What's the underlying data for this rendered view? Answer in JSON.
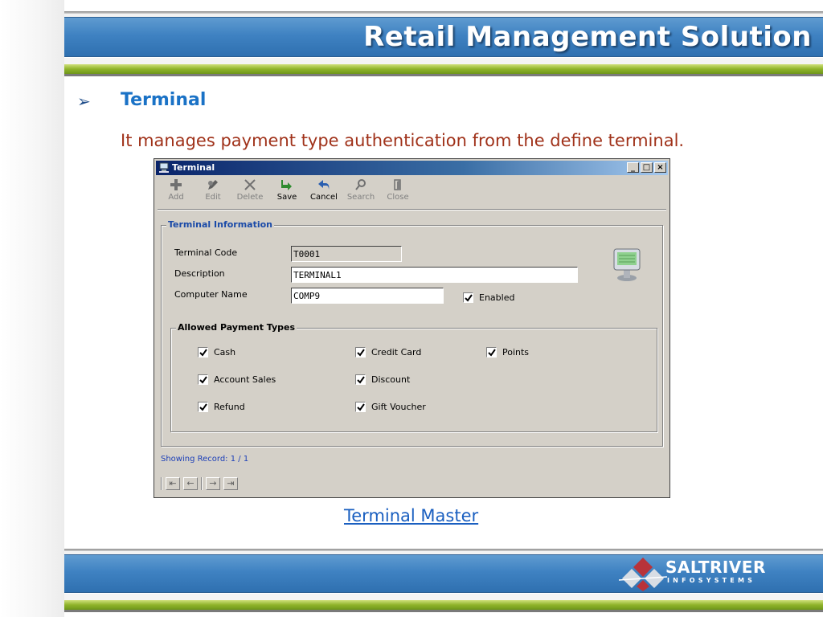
{
  "header": {
    "title": "Retail Management Solution"
  },
  "section": {
    "title": "Terminal",
    "description": "It manages payment type authentication from the define terminal."
  },
  "window": {
    "title": "Terminal",
    "controls": {
      "minimize": "_",
      "maximize": "□",
      "close": "×"
    },
    "toolbar": [
      {
        "label": "Add",
        "icon": "plus-icon",
        "enabled": false
      },
      {
        "label": "Edit",
        "icon": "edit-icon",
        "enabled": false
      },
      {
        "label": "Delete",
        "icon": "delete-icon",
        "enabled": false
      },
      {
        "label": "Save",
        "icon": "save-arrow-icon",
        "enabled": true
      },
      {
        "label": "Cancel",
        "icon": "cancel-arrow-icon",
        "enabled": true
      },
      {
        "label": "Search",
        "icon": "search-icon",
        "enabled": false
      },
      {
        "label": "Close",
        "icon": "close-door-icon",
        "enabled": false
      }
    ],
    "terminal_info": {
      "legend": "Terminal Information",
      "code_label": "Terminal Code",
      "code_value": "T0001",
      "description_label": "Description",
      "description_value": "TERMINAL1",
      "computer_label": "Computer Name",
      "computer_value": "COMP9",
      "enabled_label": "Enabled",
      "enabled": true
    },
    "payment_types": {
      "legend": "Allowed Payment Types",
      "items": [
        {
          "label": "Cash",
          "checked": true
        },
        {
          "label": "Credit Card",
          "checked": true
        },
        {
          "label": "Points",
          "checked": true
        },
        {
          "label": "Account Sales",
          "checked": true
        },
        {
          "label": "Discount",
          "checked": true
        },
        {
          "label": "Refund",
          "checked": true
        },
        {
          "label": "Gift Voucher",
          "checked": true
        }
      ]
    },
    "status": "Showing Record: 1 / 1",
    "nav": {
      "first": "⇤",
      "prev": "←",
      "next": "→",
      "last": "⇥"
    }
  },
  "caption": "Terminal Master",
  "footer": {
    "logo_name": "SALTRIVER",
    "logo_sub": "INFOSYSTEMS"
  },
  "colors": {
    "header_blue": "#3f82c2",
    "accent_green": "#8fb32a",
    "title_blue": "#1a72c6",
    "desc_red": "#a0321a"
  }
}
